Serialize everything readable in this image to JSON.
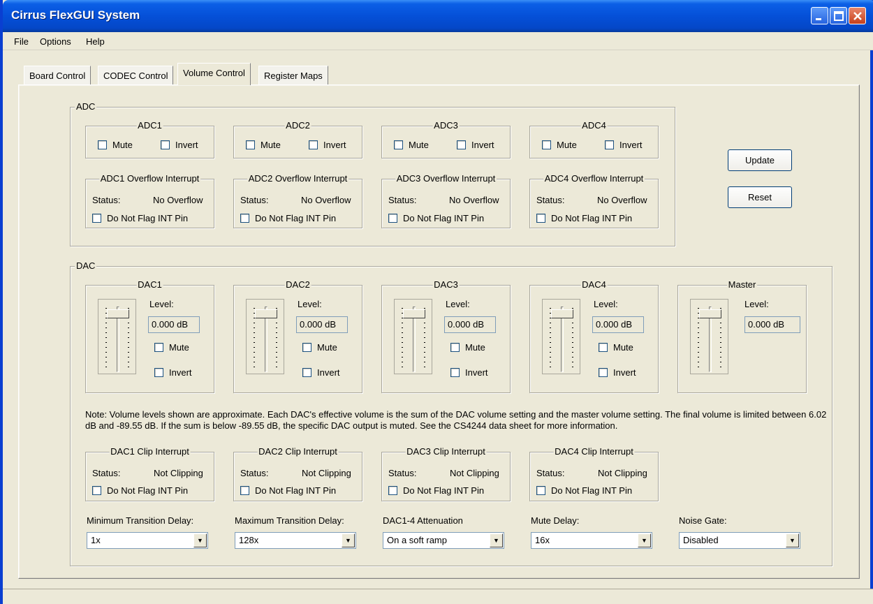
{
  "window": {
    "title": "Cirrus FlexGUI System"
  },
  "menu": {
    "items": [
      "File",
      "Options",
      "Help"
    ]
  },
  "tabs": [
    "Board Control",
    "CODEC Control",
    "Volume Control",
    "Register Maps"
  ],
  "adc": {
    "title": "ADC",
    "channels": [
      {
        "name": "ADC1",
        "interrupt": "ADC1 Overflow Interrupt"
      },
      {
        "name": "ADC2",
        "interrupt": "ADC2 Overflow Interrupt"
      },
      {
        "name": "ADC3",
        "interrupt": "ADC3 Overflow Interrupt"
      },
      {
        "name": "ADC4",
        "interrupt": "ADC4 Overflow Interrupt"
      }
    ],
    "mute_label": "Mute",
    "invert_label": "Invert",
    "status_label": "Status:",
    "status_value": "No Overflow",
    "flag_label": "Do Not Flag INT Pin"
  },
  "buttons": {
    "update": "Update",
    "reset": "Reset"
  },
  "dac": {
    "title": "DAC",
    "channels": [
      {
        "name": "DAC1",
        "level": "0.000 dB",
        "interrupt": "DAC1 Clip Interrupt"
      },
      {
        "name": "DAC2",
        "level": "0.000 dB",
        "interrupt": "DAC2 Clip Interrupt"
      },
      {
        "name": "DAC3",
        "level": "0.000 dB",
        "interrupt": "DAC3 Clip Interrupt"
      },
      {
        "name": "DAC4",
        "level": "0.000 dB",
        "interrupt": "DAC4 Clip Interrupt"
      }
    ],
    "master": {
      "name": "Master",
      "level": "0.000 dB"
    },
    "level_label": "Level:",
    "mute_label": "Mute",
    "invert_label": "Invert",
    "status_label": "Status:",
    "status_value": "Not Clipping",
    "flag_label": "Do Not Flag INT Pin",
    "note": "Note: Volume levels shown are approximate. Each DAC's effective volume is the sum of the DAC volume setting and the master volume setting. The final volume is limited between 6.02 dB and -89.55 dB. If the sum is below -89.55 dB, the specific DAC output is muted. See the CS4244 data sheet for more information.",
    "dropdowns": [
      {
        "label": "Minimum Transition Delay:",
        "value": "1x"
      },
      {
        "label": "Maximum Transition Delay:",
        "value": "128x"
      },
      {
        "label": "DAC1-4 Attenuation",
        "value": "On a soft ramp"
      },
      {
        "label": "Mute Delay:",
        "value": "16x"
      },
      {
        "label": "Noise Gate:",
        "value": "Disabled"
      }
    ]
  },
  "icons": {
    "minimize": "minimize-icon",
    "maximize": "maximize-icon",
    "close": "close-icon",
    "dropdown": "chevron-down-icon"
  }
}
